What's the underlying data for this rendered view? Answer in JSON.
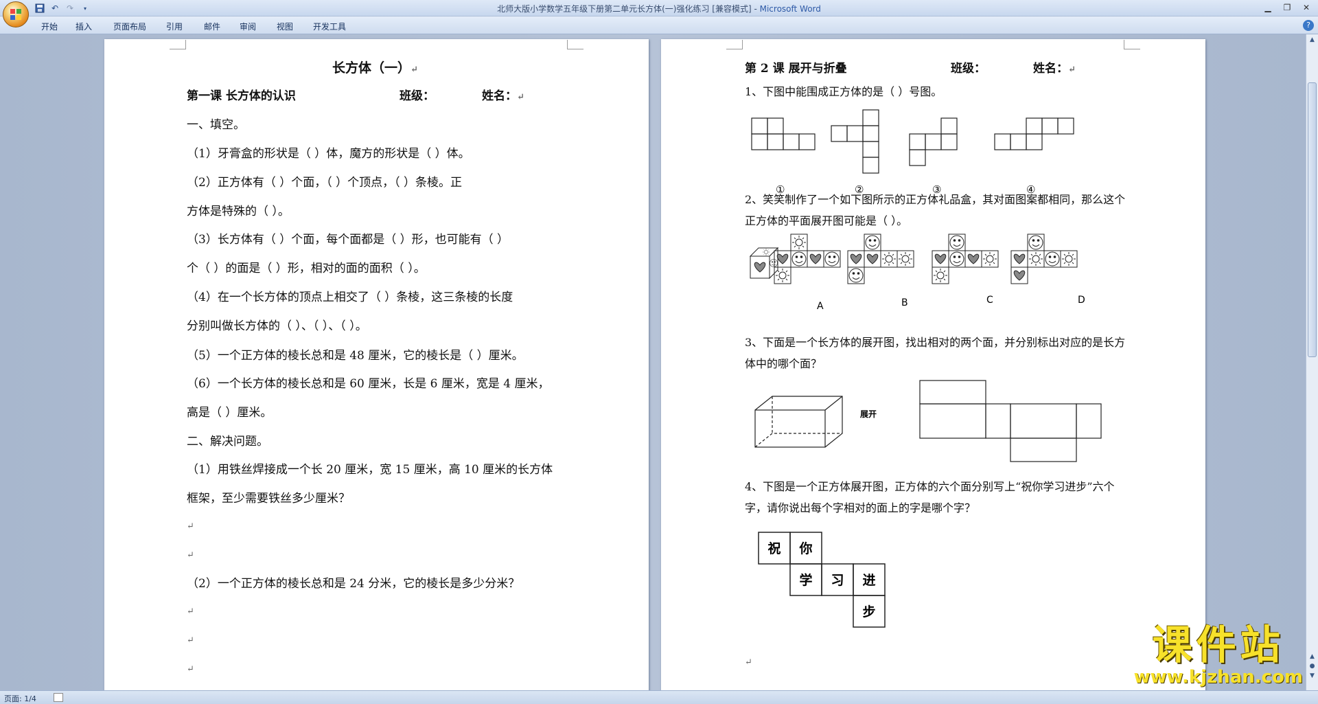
{
  "titlebar": {
    "title": "北师大版小学数学五年级下册第二单元长方体(一)强化练习 [兼容模式] - ",
    "app": "Microsoft Word"
  },
  "ribbon": {
    "tabs": [
      "开始",
      "插入",
      "页面布局",
      "引用",
      "邮件",
      "审阅",
      "视图",
      "开发工具"
    ]
  },
  "page1": {
    "title": "长方体（一）",
    "lesson": "第一课    长方体的认识",
    "class_label": "班级：",
    "name_label": "姓名：",
    "section1": "一、填空。",
    "q1": "（1）牙膏盒的形状是（        ）体，魔方的形状是（        ）体。",
    "q2a": "（2）正方体有（        ）个面，（        ）个顶点，（        ）条棱。正",
    "q2b": "方体是特殊的（          ）。",
    "q3a": "（3）长方体有（       ）个面，每个面都是（         ）形，也可能有（       ）",
    "q3b": "个（          ）的面是（              ）形，相对的面的面积（           ）。",
    "q4a": "（4）在一个长方体的顶点上相交了（          ）条棱，这三条棱的长度",
    "q4b": "分别叫做长方体的（          ）、（          ）、（          ）。",
    "q5": "（5）一个正方体的棱长总和是 48 厘米，它的棱长是（            ）厘米。",
    "q6a": "（6）一个长方体的棱长总和是 60 厘米，长是 6 厘米，宽是 4 厘米，",
    "q6b": "高是（          ）厘米。",
    "section2": "二、解决问题。",
    "p1a": "（1）用铁丝焊接成一个长 20 厘米，宽 15 厘米，高 10 厘米的长方体",
    "p1b": "框架，至少需要铁丝多少厘米？",
    "p2": "（2）一个正方体的棱长总和是 24 分米，它的棱长是多少分米？"
  },
  "page2": {
    "lesson": "第 2 课      展开与折叠",
    "class_label": "班级：",
    "name_label": "姓名：",
    "q1": "1、下图中能围成正方体的是（        ）号图。",
    "q1_labels": [
      "①",
      "②",
      "③",
      "④"
    ],
    "q2a": "2、笑笑制作了一个如下图所示的正方体礼品盒，其对面图案都相同，那么这个",
    "q2b": "正方体的平面展开图可能是（         ）。",
    "q2_labels": [
      "A",
      "B",
      "C",
      "D"
    ],
    "q3a": "3、下面是一个长方体的展开图，找出相对的两个面，并分别标出对应的是长方",
    "q3b": "体中的哪个面？",
    "q3_unfold": "展开",
    "q4a": "4、下图是一个正方体展开图，正方体的六个面分别写上“祝你学习进步”六个",
    "q4b": "字，请你说出每个字相对的面上的字是哪个字？",
    "q4_chars": [
      "祝",
      "你",
      "学",
      "习",
      "进",
      "步"
    ]
  },
  "statusbar": {
    "page": "页面: 1/4"
  },
  "watermark": {
    "main": "课件站",
    "url": "www.kjzhan.com"
  }
}
